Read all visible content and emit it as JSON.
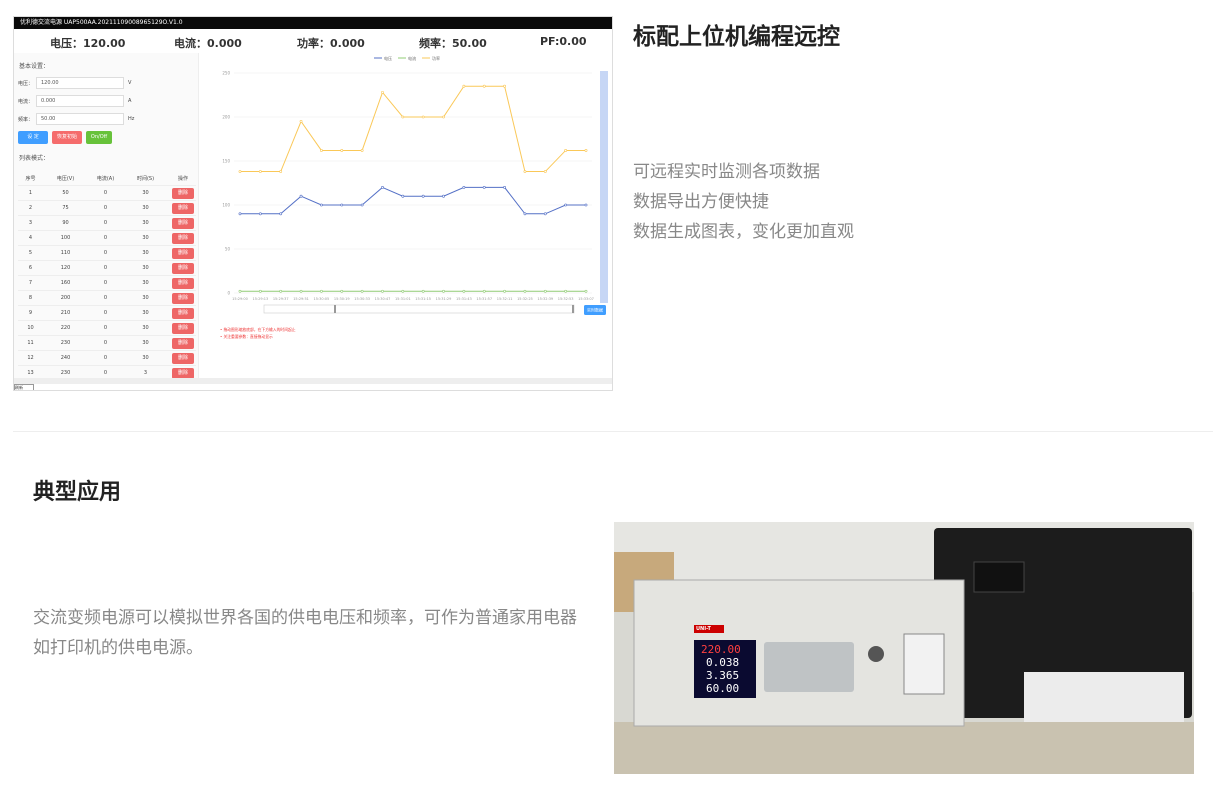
{
  "software": {
    "window_title": "优利德交流电源 UAP500AA.20211109008965129O.V1.0",
    "readouts": [
      {
        "label": "电压：",
        "value": "120.00"
      },
      {
        "label": "电流：",
        "value": "0.000"
      },
      {
        "label": "功率：",
        "value": "0.000"
      },
      {
        "label": "频率：",
        "value": "50.00"
      },
      {
        "label": "PF:",
        "value": "0.00"
      }
    ],
    "basic_settings": {
      "title": "基本设置：",
      "fields": [
        {
          "label": "电压：",
          "value": "120.00",
          "unit": "V"
        },
        {
          "label": "电流：",
          "value": "0.000",
          "unit": "A"
        },
        {
          "label": "频率：",
          "value": "50.00",
          "unit": "Hz"
        }
      ],
      "buttons": [
        "设 定",
        "恢复初始",
        "On/Off"
      ]
    },
    "list_mode": {
      "title": "列表模式：",
      "columns": [
        "序号",
        "电压(V)",
        "电流(A)",
        "时间(S)",
        "操作"
      ],
      "rows": [
        [
          "1",
          "50",
          "0",
          "30"
        ],
        [
          "2",
          "75",
          "0",
          "30"
        ],
        [
          "3",
          "90",
          "0",
          "30"
        ],
        [
          "4",
          "100",
          "0",
          "30"
        ],
        [
          "5",
          "110",
          "0",
          "30"
        ],
        [
          "6",
          "120",
          "0",
          "30"
        ],
        [
          "7",
          "160",
          "0",
          "30"
        ],
        [
          "8",
          "200",
          "0",
          "30"
        ],
        [
          "9",
          "210",
          "0",
          "30"
        ],
        [
          "10",
          "220",
          "0",
          "30"
        ],
        [
          "11",
          "230",
          "0",
          "30"
        ],
        [
          "12",
          "240",
          "0",
          "30"
        ],
        [
          "13",
          "230",
          "0",
          "3"
        ]
      ],
      "row_action": "删除"
    },
    "chart": {
      "legend": [
        "电压",
        "电流",
        "功率"
      ],
      "colors": {
        "电压": "#5470c6",
        "电流": "#91cc75",
        "功率": "#fac858"
      },
      "y_ticks": [
        "250",
        "200",
        "150",
        "100",
        "50",
        "0"
      ],
      "x_ticks": [
        "15:29:00",
        "15:29:13",
        "15:29:37",
        "15:29:51",
        "15:30:05",
        "15:30:19",
        "15:30:33",
        "15:30:47",
        "15:31:01",
        "15:31:15",
        "15:31:29",
        "15:31:43",
        "15:31:57",
        "15:32:11",
        "15:32:25",
        "15:32:39",
        "15:32:53",
        "15:33:07"
      ],
      "realtime_button": "实时数据",
      "notes": [
        "拖动图形缩放底部，在下方输入的时间起止",
        "关注重要参数：直接拖动显示"
      ]
    },
    "bottom_tab": "刷新"
  },
  "sections": {
    "remote_title": "标配上位机编程远控",
    "remote_points": [
      "可远程实时监测各项数据",
      "数据导出方便快捷",
      "数据生成图表，变化更加直观"
    ],
    "app_title": "典型应用",
    "app_text_line1": "交流变频电源可以模拟世界各国的供电电压和频率，可作为普通家用电器",
    "app_text_line2": "如打印机的供电电源。"
  },
  "photo": {
    "display_values": [
      "220.00",
      "0.038",
      "3.365",
      "60.00"
    ],
    "brand": "UNI-T"
  },
  "chart_data": {
    "type": "line",
    "x": [
      "15:29:00",
      "15:29:13",
      "15:29:37",
      "15:29:51",
      "15:30:05",
      "15:30:19",
      "15:30:33",
      "15:30:47",
      "15:31:01",
      "15:31:15",
      "15:31:29",
      "15:31:43",
      "15:31:57",
      "15:32:11",
      "15:32:25",
      "15:32:39",
      "15:32:53",
      "15:33:07"
    ],
    "ylim": [
      0,
      250
    ],
    "series": [
      {
        "name": "功率",
        "values": [
          138,
          138,
          138,
          195,
          162,
          162,
          162,
          228,
          200,
          200,
          200,
          235,
          235,
          235,
          138,
          138,
          162,
          162
        ]
      },
      {
        "name": "电压",
        "values": [
          90,
          90,
          90,
          110,
          100,
          100,
          100,
          120,
          110,
          110,
          110,
          120,
          120,
          120,
          90,
          90,
          100,
          100
        ]
      },
      {
        "name": "电流",
        "values": [
          2,
          2,
          2,
          2,
          2,
          2,
          2,
          2,
          2,
          2,
          2,
          2,
          2,
          2,
          2,
          2,
          2,
          2
        ]
      }
    ]
  }
}
